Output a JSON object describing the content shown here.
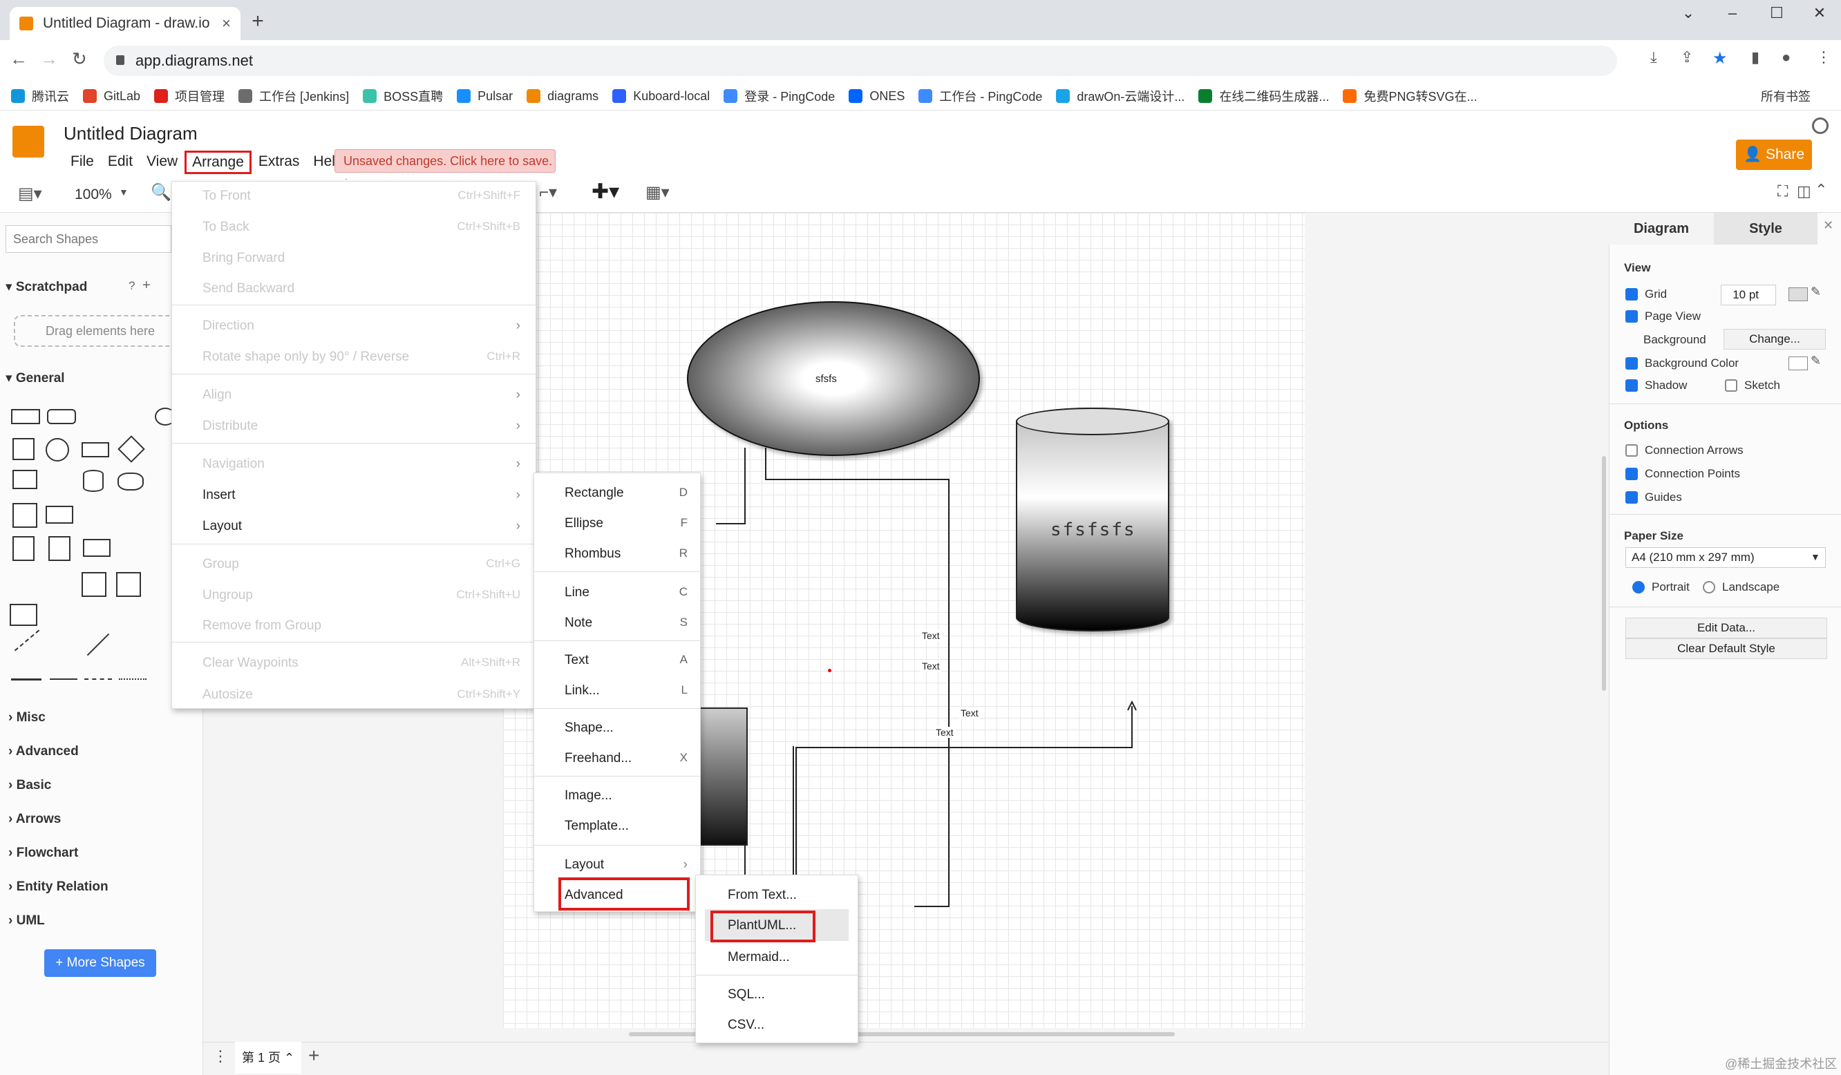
{
  "browser": {
    "tab_title": "Untitled Diagram - draw.io",
    "tab_close": "×",
    "new_tab": "+",
    "url": "app.diagrams.net",
    "bookmarks": [
      {
        "label": "腾讯云",
        "color": "#1296db"
      },
      {
        "label": "GitLab",
        "color": "#e24329"
      },
      {
        "label": "项目管理",
        "color": "#e0201b"
      },
      {
        "label": "工作台 [Jenkins]",
        "color": "#6d6b6d"
      },
      {
        "label": "BOSS直聘",
        "color": "#39c3a8"
      },
      {
        "label": "Pulsar",
        "color": "#188fff"
      },
      {
        "label": "diagrams",
        "color": "#f08705"
      },
      {
        "label": "Kuboard-local",
        "color": "#2e60ff"
      },
      {
        "label": "登录 - PingCode",
        "color": "#3e8bff"
      },
      {
        "label": "ONES",
        "color": "#0064ff"
      },
      {
        "label": "工作台 - PingCode",
        "color": "#3e8bff"
      },
      {
        "label": "drawOn-云端设计...",
        "color": "#1aa3e8"
      },
      {
        "label": "在线二维码生成器...",
        "color": "#0a7e2f"
      },
      {
        "label": "免费PNG转SVG在...",
        "color": "#ff6a00"
      }
    ],
    "all_bookmarks": "所有书签"
  },
  "header": {
    "title": "Untitled Diagram",
    "menus": [
      "File",
      "Edit",
      "View",
      "Arrange",
      "Extras",
      "Help"
    ],
    "unsaved": "Unsaved changes. Click here to save.",
    "share": "Share"
  },
  "toolbar": {
    "zoom": "100%"
  },
  "left": {
    "search_placeholder": "Search Shapes",
    "scratchpad": "Scratchpad",
    "drag_hint": "Drag elements here",
    "general": "General",
    "sections": [
      "Misc",
      "Advanced",
      "Basic",
      "Arrows",
      "Flowchart",
      "Entity Relation",
      "UML"
    ],
    "more_shapes": "+ More Shapes"
  },
  "canvas": {
    "ellipse_text": "sfsfs",
    "cylinder_text": "sfsfsfs",
    "labels": [
      "Text",
      "Text",
      "Text",
      "Text"
    ]
  },
  "arrange_menu": {
    "items": [
      {
        "label": "To Front",
        "shortcut": "Ctrl+Shift+F",
        "disabled": true
      },
      {
        "label": "To Back",
        "shortcut": "Ctrl+Shift+B",
        "disabled": true
      },
      {
        "label": "Bring Forward",
        "shortcut": "",
        "disabled": true
      },
      {
        "label": "Send Backward",
        "shortcut": "",
        "disabled": true
      },
      {
        "label": "Direction",
        "shortcut": "",
        "disabled": true
      },
      {
        "label": "Rotate shape only by 90° / Reverse",
        "shortcut": "Ctrl+R",
        "disabled": true
      },
      {
        "label": "Align",
        "shortcut": "",
        "disabled": true
      },
      {
        "label": "Distribute",
        "shortcut": "",
        "disabled": true
      },
      {
        "label": "Navigation",
        "shortcut": "",
        "disabled": true
      },
      {
        "label": "Insert",
        "shortcut": "",
        "disabled": false
      },
      {
        "label": "Layout",
        "shortcut": "",
        "disabled": false
      },
      {
        "label": "Group",
        "shortcut": "Ctrl+G",
        "disabled": true
      },
      {
        "label": "Ungroup",
        "shortcut": "Ctrl+Shift+U",
        "disabled": true
      },
      {
        "label": "Remove from Group",
        "shortcut": "",
        "disabled": true
      },
      {
        "label": "Clear Waypoints",
        "shortcut": "Alt+Shift+R",
        "disabled": true
      },
      {
        "label": "Autosize",
        "shortcut": "Ctrl+Shift+Y",
        "disabled": true
      }
    ]
  },
  "insert_menu": {
    "items": [
      {
        "label": "Rectangle",
        "shortcut": "D"
      },
      {
        "label": "Ellipse",
        "shortcut": "F"
      },
      {
        "label": "Rhombus",
        "shortcut": "R"
      },
      {
        "label": "Line",
        "shortcut": "C"
      },
      {
        "label": "Note",
        "shortcut": "S"
      },
      {
        "label": "Text",
        "shortcut": "A"
      },
      {
        "label": "Link...",
        "shortcut": "L"
      },
      {
        "label": "Shape...",
        "shortcut": ""
      },
      {
        "label": "Freehand...",
        "shortcut": "X"
      },
      {
        "label": "Image...",
        "shortcut": ""
      },
      {
        "label": "Template...",
        "shortcut": ""
      },
      {
        "label": "Layout",
        "shortcut": ""
      },
      {
        "label": "Advanced",
        "shortcut": ""
      }
    ]
  },
  "advanced_menu": {
    "items": [
      "From Text...",
      "PlantUML...",
      "Mermaid...",
      "SQL...",
      "CSV..."
    ]
  },
  "right": {
    "tab_diagram": "Diagram",
    "tab_style": "Style",
    "view": "View",
    "grid": "Grid",
    "grid_size": "10 pt",
    "page_view": "Page View",
    "background": "Background",
    "change": "Change...",
    "background_color": "Background Color",
    "shadow": "Shadow",
    "sketch": "Sketch",
    "options": "Options",
    "connection_arrows": "Connection Arrows",
    "connection_points": "Connection Points",
    "guides": "Guides",
    "paper_size": "Paper Size",
    "paper_value": "A4 (210 mm x 297 mm)",
    "portrait": "Portrait",
    "landscape": "Landscape",
    "edit_data": "Edit Data...",
    "clear_style": "Clear Default Style"
  },
  "bottom": {
    "page_tab": "第 1 页",
    "watermark": "@稀土掘金技术社区"
  }
}
